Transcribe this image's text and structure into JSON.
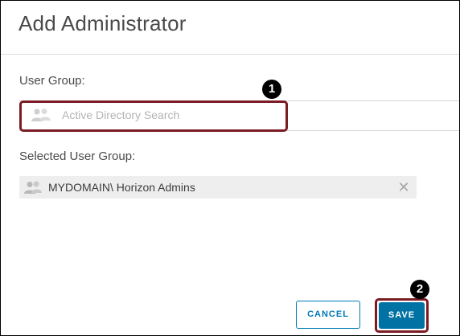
{
  "dialog": {
    "title": "Add Administrator",
    "user_group_label": "User Group:",
    "search_placeholder": "Active Directory Search",
    "selected_label": "Selected User Group:",
    "selected_items": [
      {
        "name": "MYDOMAIN\\ Horizon Admins",
        "icon": "user-group-icon",
        "remove_icon": "close-icon"
      }
    ],
    "cancel_label": "CANCEL",
    "save_label": "SAVE"
  },
  "callouts": {
    "step1": "1",
    "step2": "2"
  },
  "icons": {
    "search_field": "user-group-icon",
    "selected_item": "user-group-icon",
    "remove": "close-icon"
  },
  "colors": {
    "primary": "#0072a3",
    "highlight": "#7b1b24",
    "callout": "#000000"
  }
}
